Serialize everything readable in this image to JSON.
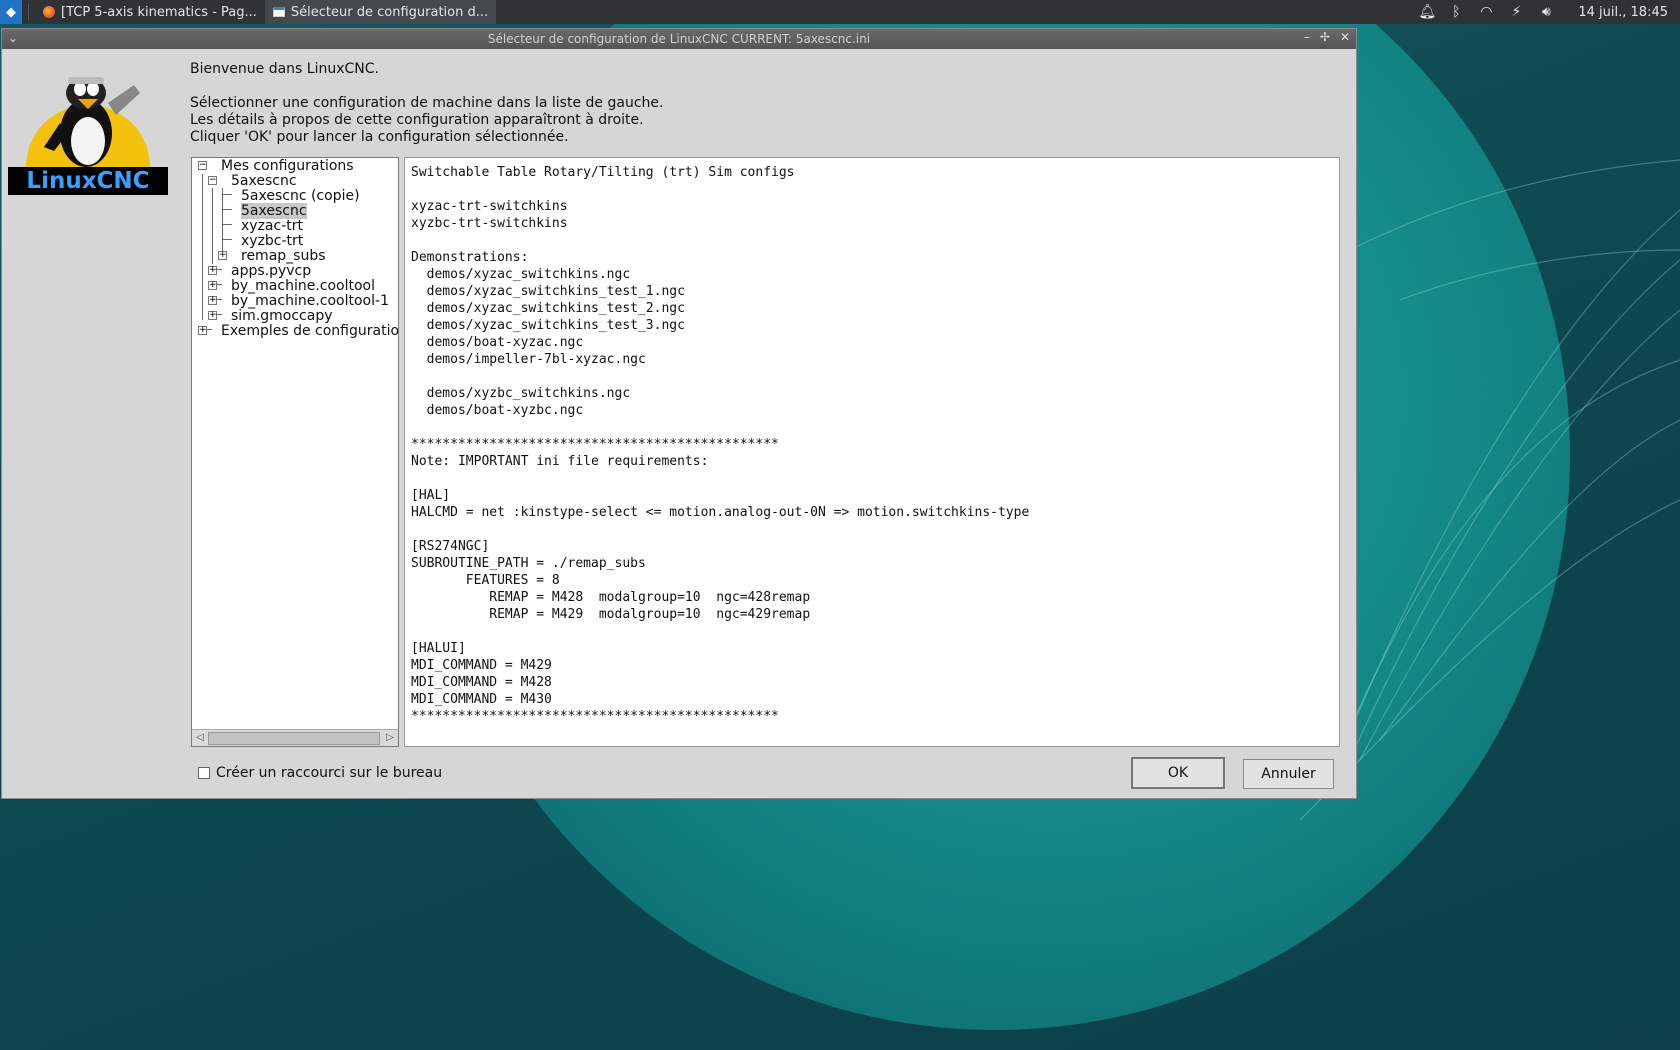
{
  "taskbar": {
    "tasks": [
      {
        "label": "[TCP 5-axis kinematics - Pag..."
      },
      {
        "label": "Sélecteur de configuration d..."
      }
    ],
    "clock": "14 juil., 18:45"
  },
  "window": {
    "title": "Sélecteur de configuration de LinuxCNC  CURRENT: 5axescnc.ini",
    "logo_text": "LinuxCNC",
    "intro": {
      "welcome": "Bienvenue dans LinuxCNC.",
      "line1": "Sélectionner une configuration de machine dans la liste de gauche.",
      "line2": "Les détails à propos de cette configuration apparaîtront à droite.",
      "line3": "Cliquer 'OK' pour lancer la configuration sélectionnée."
    },
    "tree": {
      "root_mine": "Mes configurations",
      "group_5axescnc": "5axescnc",
      "item_copie": "5axescnc (copie)",
      "item_5axescnc": "5axescnc",
      "item_xyzac": "xyzac-trt",
      "item_xyzbc": "xyzbc-trt",
      "item_remap": "remap_subs",
      "item_pyvcp": "apps.pyvcp",
      "item_cooltool": "by_machine.cooltool",
      "item_cooltool1": "by_machine.cooltool-1",
      "item_gmoccapy": "sim.gmoccapy",
      "root_examples": "Exemples de configuration"
    },
    "details_text": "Switchable Table Rotary/Tilting (trt) Sim configs\n\nxyzac-trt-switchkins\nxyzbc-trt-switchkins\n\nDemonstrations:\n  demos/xyzac_switchkins.ngc\n  demos/xyzac_switchkins_test_1.ngc\n  demos/xyzac_switchkins_test_2.ngc\n  demos/xyzac_switchkins_test_3.ngc\n  demos/boat-xyzac.ngc\n  demos/impeller-7bl-xyzac.ngc\n\n  demos/xyzbc_switchkins.ngc\n  demos/boat-xyzbc.ngc\n\n***********************************************\nNote: IMPORTANT ini file requirements:\n\n[HAL]\nHALCMD = net :kinstype-select <= motion.analog-out-0N => motion.switchkins-type\n\n[RS274NGC]\nSUBROUTINE_PATH = ./remap_subs\n       FEATURES = 8\n          REMAP = M428  modalgroup=10  ngc=428remap\n          REMAP = M429  modalgroup=10  ngc=429remap\n\n[HALUI]\nMDI_COMMAND = M429\nMDI_COMMAND = M428\nMDI_COMMAND = M430\n***********************************************",
    "shortcut_label": "Créer un raccourci sur le bureau",
    "ok_label": "OK",
    "cancel_label": "Annuler"
  }
}
